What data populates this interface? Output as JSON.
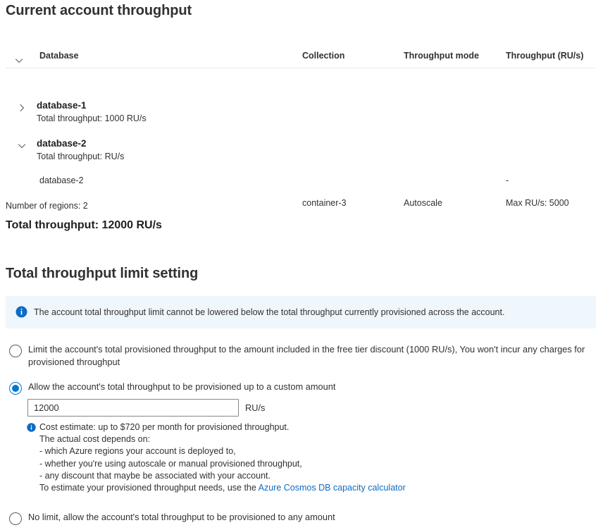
{
  "page_title": "Current account throughput",
  "section_title": "Total throughput limit setting",
  "colors": {
    "accent": "#0078d4",
    "link": "#0f6cbd",
    "banner_bg": "#eff6fc",
    "text": "#323130",
    "border": "#8a8886"
  },
  "table": {
    "header_chevron_icon": "chevron-down-icon",
    "columns": [
      {
        "key": "database",
        "label": "Database"
      },
      {
        "key": "collection",
        "label": "Collection"
      },
      {
        "key": "mode",
        "label": "Throughput mode"
      },
      {
        "key": "ru",
        "label": "Throughput (RU/s)"
      }
    ],
    "databases": [
      {
        "name": "database-1",
        "subtitle": "Total throughput: 1000 RU/s",
        "chevron_icon": "chevron-right-icon",
        "expanded": false
      },
      {
        "name": "database-2",
        "subtitle": "Total throughput: RU/s",
        "chevron_icon": "chevron-down-icon",
        "expanded": true
      }
    ],
    "child_rows": [
      {
        "database": "database-2",
        "collection": "",
        "mode": "",
        "ru": "-"
      },
      {
        "database": "",
        "collection": "container-3",
        "mode": "Autoscale",
        "ru": "Max RU/s: 5000"
      }
    ]
  },
  "summary": {
    "regions": "Number of regions: 2",
    "total_throughput": "Total throughput: 12000 RU/s"
  },
  "banner": {
    "icon": "info-icon",
    "text": "The account total throughput limit cannot be lowered below the total throughput currently provisioned across the account."
  },
  "options": [
    {
      "id": "free-tier-limit",
      "selected": false,
      "label": "Limit the account's total provisioned throughput to the amount included in the free tier discount (1000 RU/s), You won't incur any charges for provisioned throughput"
    },
    {
      "id": "custom-amount",
      "selected": true,
      "label": "Allow the account's total throughput to be provisioned up to a custom amount"
    },
    {
      "id": "no-limit",
      "selected": false,
      "label": "No limit, allow the account's total throughput to be provisioned to any amount"
    }
  ],
  "amount": {
    "value": "12000",
    "placeholder": "",
    "unit": "RU/s"
  },
  "cost_estimate": {
    "icon": "info-icon",
    "line1": "Cost estimate: up to $720 per month for provisioned throughput.",
    "line2": "The actual cost depends on:",
    "line3": "- which Azure regions your account is deployed to,",
    "line4": "- whether you're using autoscale or manual provisioned throughput,",
    "line5": "- any discount that maybe be associated with your account.",
    "line6_prefix": "To estimate your provisioned throughput needs, use the ",
    "link_text": "Azure Cosmos DB capacity calculator"
  }
}
